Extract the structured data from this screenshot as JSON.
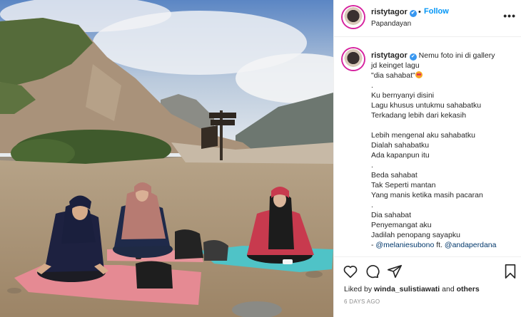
{
  "post": {
    "username": "ristytagor",
    "verified_badge": "✔",
    "follow_label": "Follow",
    "separator": "•",
    "location": "Papandayan",
    "more_icon": "more-horizontal-icon"
  },
  "photo": {
    "sign_lines": [
      "",
      ""
    ],
    "mats": {
      "left": "#e58a93",
      "right": "#4fc3c7"
    }
  },
  "caption": {
    "username": "ristytagor",
    "lines": [
      "Nemu foto ini di gallery",
      "jd keinget lagu",
      "\"dia sahabat\"",
      ".",
      "Ku bernyanyi disini",
      "Lagu khusus untukmu sahabatku",
      "Terkadang lebih dari kekasih",
      "",
      "Lebih mengenal aku sahabatku",
      "Dialah sahabatku",
      "Ada kapanpun itu",
      ".",
      "Beda sahabat",
      "Tak Seperti mantan",
      "Yang manis ketika masih pacaran",
      ".",
      "Dia sahabat",
      "Penyemangat aku",
      "Jadilah penopang sayapku"
    ],
    "mention_prefix": "- ",
    "mention_1": "@melaniesubono",
    "mention_joiner": " ft. ",
    "mention_2": "@andaperdana"
  },
  "actions": {
    "icons": [
      "heart-icon",
      "comment-icon",
      "share-icon",
      "bookmark-icon"
    ],
    "liked_prefix": "Liked by ",
    "liked_user": "winda_sulistiawati",
    "liked_mid": " and ",
    "liked_others": "others",
    "timestamp": "6 DAYS AGO"
  },
  "colors": {
    "follow": "#0095f6",
    "verified": "#3897f0",
    "mention": "#00376b",
    "story_ring": "#d6249f"
  }
}
